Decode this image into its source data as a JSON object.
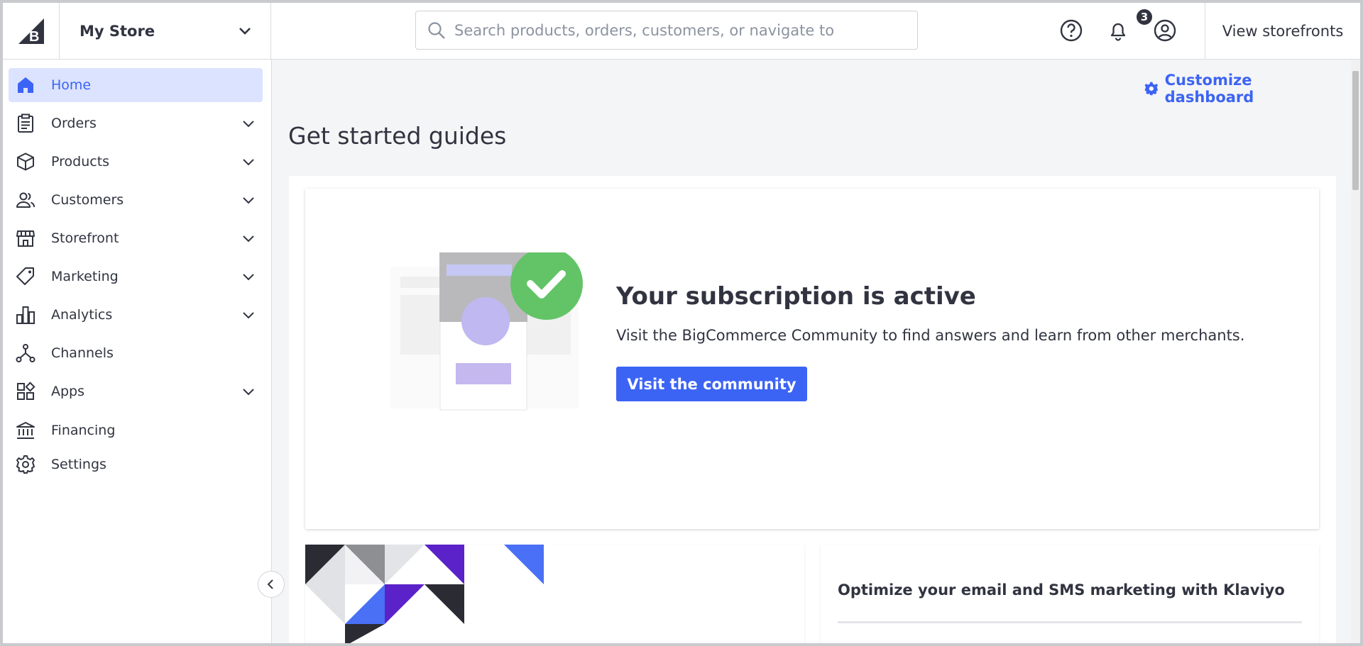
{
  "header": {
    "store_name": "My Store",
    "search_placeholder": "Search products, orders, customers, or navigate to",
    "notification_count": "3",
    "view_storefronts": "View storefronts"
  },
  "sidebar": {
    "items": [
      {
        "label": "Home",
        "icon": "home-icon",
        "active": true,
        "expandable": false
      },
      {
        "label": "Orders",
        "icon": "orders-icon",
        "active": false,
        "expandable": true
      },
      {
        "label": "Products",
        "icon": "products-icon",
        "active": false,
        "expandable": true
      },
      {
        "label": "Customers",
        "icon": "customers-icon",
        "active": false,
        "expandable": true
      },
      {
        "label": "Storefront",
        "icon": "storefront-icon",
        "active": false,
        "expandable": true
      },
      {
        "label": "Marketing",
        "icon": "tag-icon",
        "active": false,
        "expandable": true
      },
      {
        "label": "Analytics",
        "icon": "analytics-icon",
        "active": false,
        "expandable": true
      },
      {
        "label": "Channels",
        "icon": "channels-icon",
        "active": false,
        "expandable": false
      },
      {
        "label": "Apps",
        "icon": "apps-icon",
        "active": false,
        "expandable": true
      },
      {
        "label": "Financing",
        "icon": "bank-icon",
        "active": false,
        "expandable": false
      },
      {
        "label": "Settings",
        "icon": "gear-icon",
        "active": false,
        "expandable": false
      }
    ]
  },
  "main": {
    "customize_label": "Customize dashboard",
    "page_title": "Get started guides",
    "subscription": {
      "title": "Your subscription is active",
      "text": "Visit the BigCommerce Community to find answers and learn from other merchants.",
      "button": "Visit the community"
    },
    "klaviyo_card": {
      "title": "Optimize your email and SMS marketing with Klaviyo"
    }
  },
  "colors": {
    "accent": "#3c64f4",
    "active_bg": "#dbe3fe",
    "success": "#62c466",
    "text": "#313440"
  }
}
